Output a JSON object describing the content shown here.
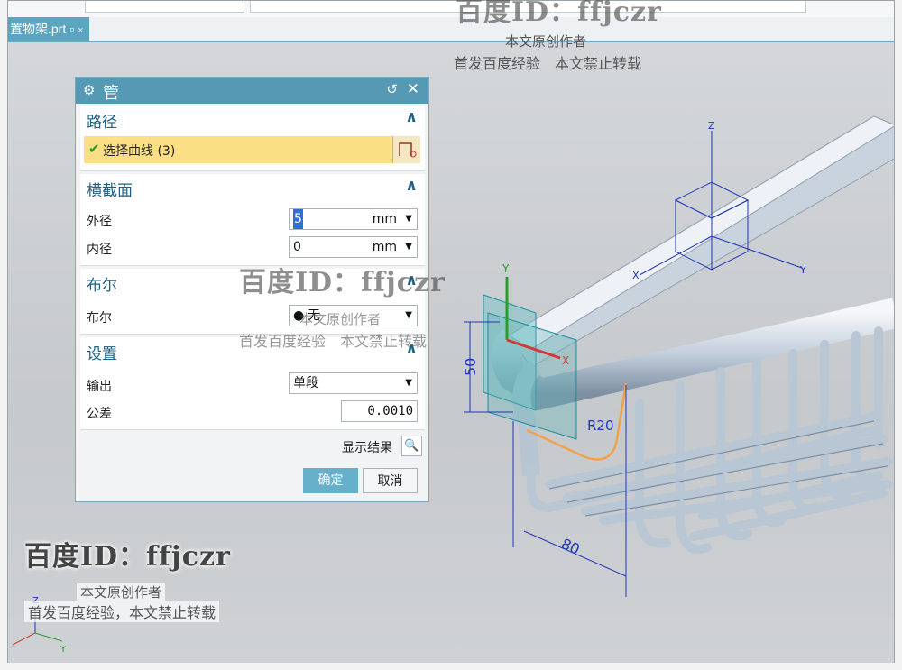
{
  "tab": {
    "label": "置物架.prt",
    "pin_icon": "pin-icon",
    "close": "×"
  },
  "dialog": {
    "title": "管",
    "sections": {
      "path": {
        "label": "路径",
        "select_curve": "选择曲线 (3)"
      },
      "cross_section": {
        "label": "横截面",
        "outer_label": "外径",
        "outer_value": "5",
        "outer_unit": "mm",
        "inner_label": "内径",
        "inner_value": "0",
        "inner_unit": "mm"
      },
      "boolean": {
        "label": "布尔",
        "row_label": "布尔",
        "value": "无"
      },
      "settings": {
        "label": "设置",
        "output_label": "输出",
        "output_value": "单段",
        "tolerance_label": "公差",
        "tolerance_value": "0.0010"
      }
    },
    "show_result": "显示结果",
    "ok": "确定",
    "cancel": "取消"
  },
  "dimensions": {
    "d50": "50",
    "r20": "R20",
    "d80": "80"
  },
  "axes": {
    "x": "X",
    "y": "Y",
    "z": "Z"
  },
  "watermarks": {
    "top_line1": "百度ID：ffjczr",
    "top_line2": "本文原创作者",
    "top_line3": "首发百度经验　本文禁止转载",
    "mid_line1": "百度ID：ffjczr",
    "mid_line2": "本文原创作者",
    "mid_line3": "首发百度经验　本文禁止转载",
    "bl_line1": "百度ID：ffjczr",
    "bl_line2": "本文原创作者",
    "bl_line3": "首发百度经验，本文禁止转载"
  },
  "colors": {
    "dialog_title": "#5599b5",
    "highlight": "#fbdf84",
    "ok_button": "#67b0cc",
    "accent_text": "#1e5f80"
  }
}
